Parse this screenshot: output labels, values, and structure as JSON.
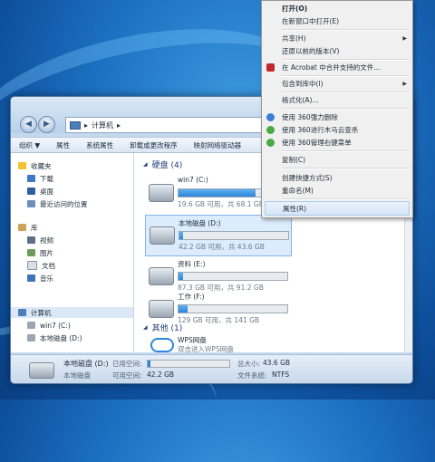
{
  "window": {
    "address": "计算机",
    "toolbar": [
      "组织 ▼",
      "属性",
      "系统属性",
      "卸载或更改程序",
      "映射网络驱动器"
    ],
    "sidebar": {
      "favorites": "收藏夹",
      "fav_items": [
        "下载",
        "桌面",
        "最近访问的位置"
      ],
      "libraries": "库",
      "lib_items": [
        "视频",
        "图片",
        "文档",
        "音乐"
      ],
      "computer": "计算机",
      "comp_items": [
        "win7 (C:)",
        "本地磁盘 (D:)"
      ]
    },
    "groups": {
      "hard_disks": "硬盘 (4)",
      "other": "其他 (1)"
    },
    "drives": [
      {
        "name": "win7 (C:)",
        "size": "19.6 GB 可用，共 68.1 GB",
        "used": 0.71
      },
      {
        "name": "本地磁盘 (D:)",
        "size": "42.2 GB 可用，共 43.6 GB",
        "used": 0.03
      },
      {
        "name": "资料 (E:)",
        "size": "87.3 GB 可用，共 91.2 GB",
        "used": 0.04
      },
      {
        "name": "工作 (F:)",
        "size": "129 GB 可用，共 141 GB",
        "used": 0.08
      }
    ],
    "other_items": [
      {
        "name": "WPS网盘",
        "sub": "双击进入WPS网盘"
      }
    ],
    "details": {
      "name": "本地磁盘 (D:)",
      "space_used_label": "已用空间:",
      "space_free_label": "可用空间:",
      "free": "42.2 GB",
      "total_label": "总大小:",
      "total": "43.6 GB",
      "fs_label": "文件系统:",
      "fs": "NTFS",
      "type": "本地磁盘"
    }
  },
  "context_menu": [
    {
      "label": "打开(O)",
      "bold": true
    },
    {
      "label": "在新窗口中打开(E)"
    },
    {
      "sep": true
    },
    {
      "label": "共享(H)",
      "arrow": true
    },
    {
      "label": "还原以前的版本(V)"
    },
    {
      "sep": true
    },
    {
      "label": "在 Acrobat 中合并支持的文件...",
      "icon": "acrobat-icon"
    },
    {
      "sep": true
    },
    {
      "label": "包含到库中(I)",
      "arrow": true
    },
    {
      "sep": true
    },
    {
      "label": "格式化(A)..."
    },
    {
      "sep": true
    },
    {
      "label": "使用 360强力删除",
      "icon": "360-delete-icon"
    },
    {
      "label": "使用 360进行木马云查杀",
      "icon": "360-scan-icon"
    },
    {
      "label": "使用 360管理右键菜单",
      "icon": "360-menu-icon"
    },
    {
      "sep": true
    },
    {
      "label": "复制(C)"
    },
    {
      "sep": true
    },
    {
      "label": "创建快捷方式(S)"
    },
    {
      "label": "重命名(M)"
    },
    {
      "sep": true
    },
    {
      "label": "属性(R)",
      "highlight": true
    }
  ],
  "colors": {
    "accent": "#2a86d8",
    "selection": "#dcecfc"
  }
}
